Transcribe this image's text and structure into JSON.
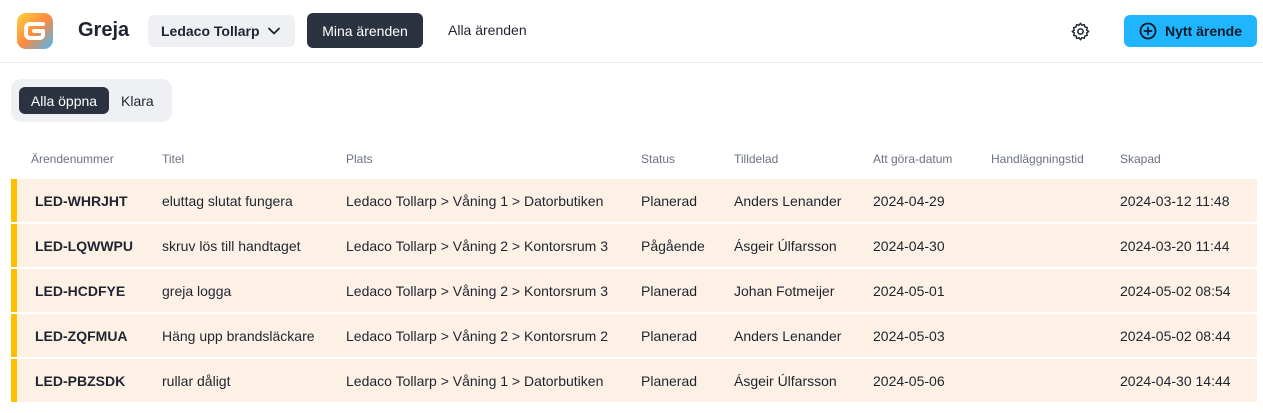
{
  "header": {
    "app_name": "Greja",
    "org_selector": "Ledaco Tollarp",
    "tab_mine": "Mina ärenden",
    "tab_all": "Alla ärenden",
    "new_button": "Nytt ärende",
    "icons": {
      "logo": "greja-logo",
      "org_chevron": "chevron-down-icon",
      "settings": "gear-icon",
      "new": "plus-circle-icon"
    },
    "colors": {
      "primary_dark": "#2c3340",
      "accent": "#1fb6ff"
    }
  },
  "filters": {
    "open_label": "Alla öppna",
    "done_label": "Klara"
  },
  "table": {
    "columns": [
      "Ärendenummer",
      "Titel",
      "Plats",
      "Status",
      "Tilldelad",
      "Att göra-datum",
      "Handläggningstid",
      "Skapad"
    ],
    "row_color": "#fdf1e6",
    "row_marker_color": "#ffbf00",
    "rows": [
      {
        "id": "LED-WHRJHT",
        "title": "eluttag slutat fungera",
        "place": "Ledaco Tollarp > Våning 1 > Datorbutiken",
        "status": "Planerad",
        "assigned": "Anders Lenander",
        "due": "2024-04-29",
        "handling": "",
        "created": "2024-03-12 11:48"
      },
      {
        "id": "LED-LQWWPU",
        "title": "skruv lös till handtaget",
        "place": "Ledaco Tollarp > Våning 2 > Kontorsrum 3",
        "status": "Pågående",
        "assigned": "Ásgeir Úlfarsson",
        "due": "2024-04-30",
        "handling": "",
        "created": "2024-03-20 11:44"
      },
      {
        "id": "LED-HCDFYE",
        "title": "greja logga",
        "place": "Ledaco Tollarp > Våning 2 > Kontorsrum 3",
        "status": "Planerad",
        "assigned": "Johan Fotmeijer",
        "due": "2024-05-01",
        "handling": "",
        "created": "2024-05-02 08:54"
      },
      {
        "id": "LED-ZQFMUA",
        "title": "Häng upp brandsläckare",
        "place": "Ledaco Tollarp > Våning 2 > Kontorsrum 2",
        "status": "Planerad",
        "assigned": "Anders Lenander",
        "due": "2024-05-03",
        "handling": "",
        "created": "2024-05-02 08:44"
      },
      {
        "id": "LED-PBZSDK",
        "title": "rullar dåligt",
        "place": "Ledaco Tollarp > Våning 1 > Datorbutiken",
        "status": "Planerad",
        "assigned": "Ásgeir Úlfarsson",
        "due": "2024-05-06",
        "handling": "",
        "created": "2024-04-30 14:44"
      }
    ]
  }
}
